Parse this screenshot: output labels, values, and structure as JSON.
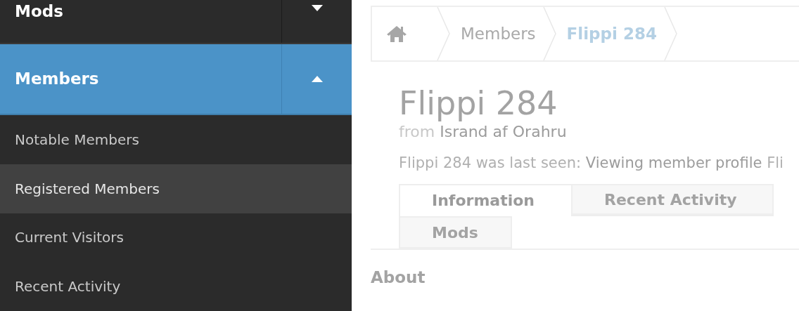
{
  "sidebar": {
    "sections": [
      {
        "label": "Mods",
        "active": false,
        "expanded": false
      },
      {
        "label": "Members",
        "active": true,
        "expanded": true
      }
    ],
    "items": [
      {
        "label": "Notable Members",
        "selected": false
      },
      {
        "label": "Registered Members",
        "selected": true
      },
      {
        "label": "Current Visitors",
        "selected": false
      },
      {
        "label": "Recent Activity",
        "selected": false
      }
    ]
  },
  "breadcrumb": [
    {
      "label": "Members",
      "current": false
    },
    {
      "label": "Flippi 284",
      "current": true
    }
  ],
  "profile": {
    "name": "Flippi 284",
    "from_label": "from",
    "location": "Isrand af Orahru",
    "last_seen": {
      "prefix": "Flippi 284 was last seen:",
      "activity": "Viewing member profile",
      "suffix": "Fli"
    }
  },
  "tabs": [
    {
      "label": "Information",
      "selected": true
    },
    {
      "label": "Recent Activity",
      "selected": false
    },
    {
      "label": "Mods",
      "selected": false
    }
  ],
  "section_heading": "About"
}
